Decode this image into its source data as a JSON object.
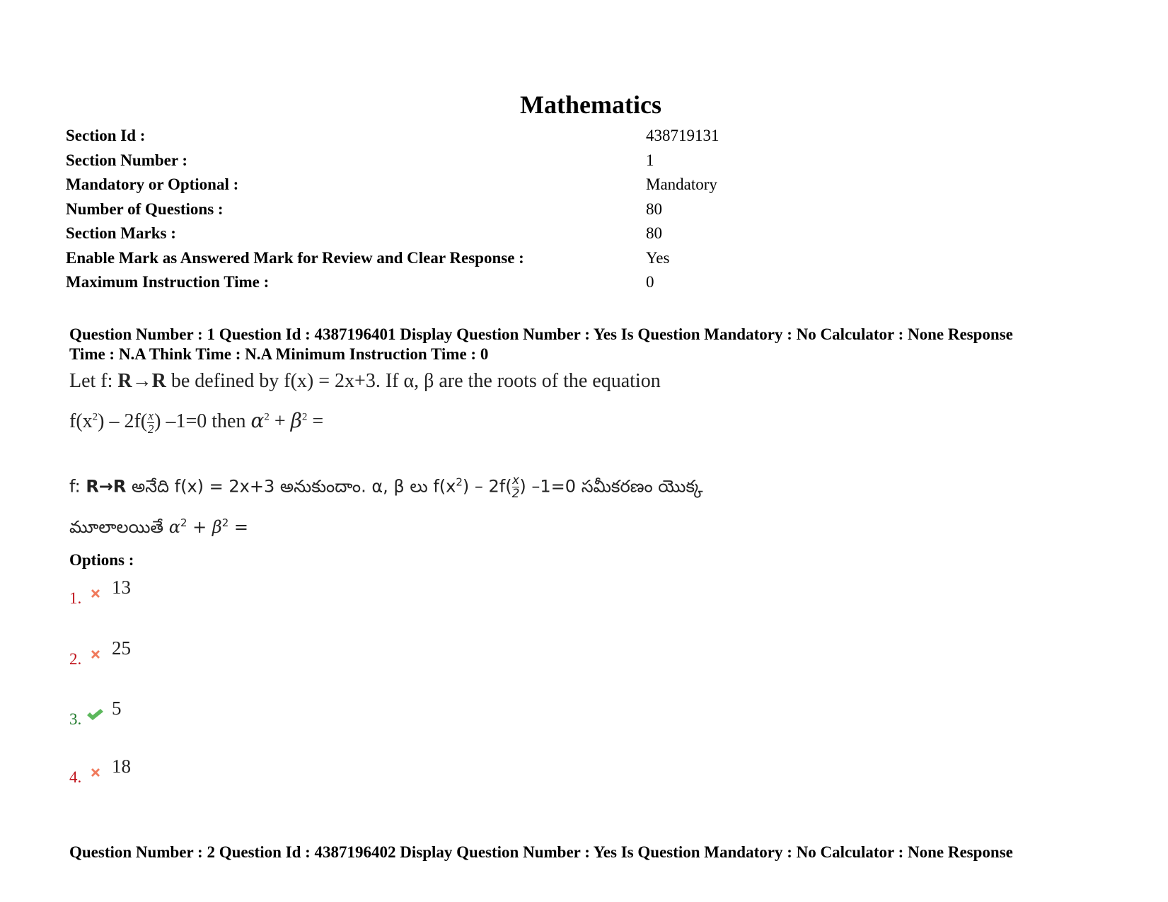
{
  "section": {
    "title": "Mathematics",
    "fields": [
      {
        "label": "Section Id :",
        "value": "438719131"
      },
      {
        "label": "Section Number :",
        "value": "1"
      },
      {
        "label": "Mandatory or Optional :",
        "value": "Mandatory"
      },
      {
        "label": "Number of Questions :",
        "value": "80"
      },
      {
        "label": "Section Marks :",
        "value": "80"
      },
      {
        "label": "Enable Mark as Answered Mark for Review and Clear Response :",
        "value": "Yes"
      },
      {
        "label": "Maximum Instruction Time :",
        "value": "0"
      }
    ]
  },
  "question1": {
    "header_line1": "Question Number : 1 Question Id : 4387196401 Display Question Number : Yes Is Question Mandatory : No Calculator : None Response",
    "header_line2": "Time : N.A Think Time : N.A Minimum Instruction Time : 0",
    "english": {
      "line1_a": "Let f: ",
      "line1_bold": "R→R",
      "line1_b": " be defined by f(x) = 2x+3. If α, β are the roots of the equation",
      "line2_a": "f(x",
      "line2_sup": "2",
      "line2_b": ") – 2f(",
      "frac_num": "x",
      "frac_den": "2",
      "line2_c": ") –1=0 then ",
      "alpha": "α",
      "beta": "β",
      "sq": "2",
      "plus": " + ",
      "equals": " ="
    },
    "telugu": {
      "line1_a": "f: ",
      "line1_bold": "R→R",
      "line1_b": " అనేది f(x) = 2x+3 అనుకుందాం. α, β లు f(x",
      "line1_sup": "2",
      "line1_c": ") – 2f(",
      "frac_num": "x",
      "frac_den": "2",
      "line1_d": ") –1=0 సమీకరణం యొక్క",
      "line2_a": "మూలాలయితే ",
      "alpha": "α",
      "beta": "β",
      "sq": "2",
      "plus": " + ",
      "equals": " ="
    },
    "options_label": "Options :",
    "options": [
      {
        "number": "1.",
        "value": "13",
        "status": "wrong",
        "icon": "cross-icon"
      },
      {
        "number": "2.",
        "value": "25",
        "status": "wrong",
        "icon": "cross-icon"
      },
      {
        "number": "3.",
        "value": "5",
        "status": "correct",
        "icon": "check-icon"
      },
      {
        "number": "4.",
        "value": "18",
        "status": "wrong",
        "icon": "cross-icon"
      }
    ]
  },
  "question2": {
    "header_line1": "Question Number : 2 Question Id : 4387196402 Display Question Number : Yes Is Question Mandatory : No Calculator : None Response"
  },
  "colors": {
    "wrong": "#c0141c",
    "correct": "#1e7a2a",
    "cross_icon": "#f07a5c",
    "check_icon": "#5cb85c"
  }
}
